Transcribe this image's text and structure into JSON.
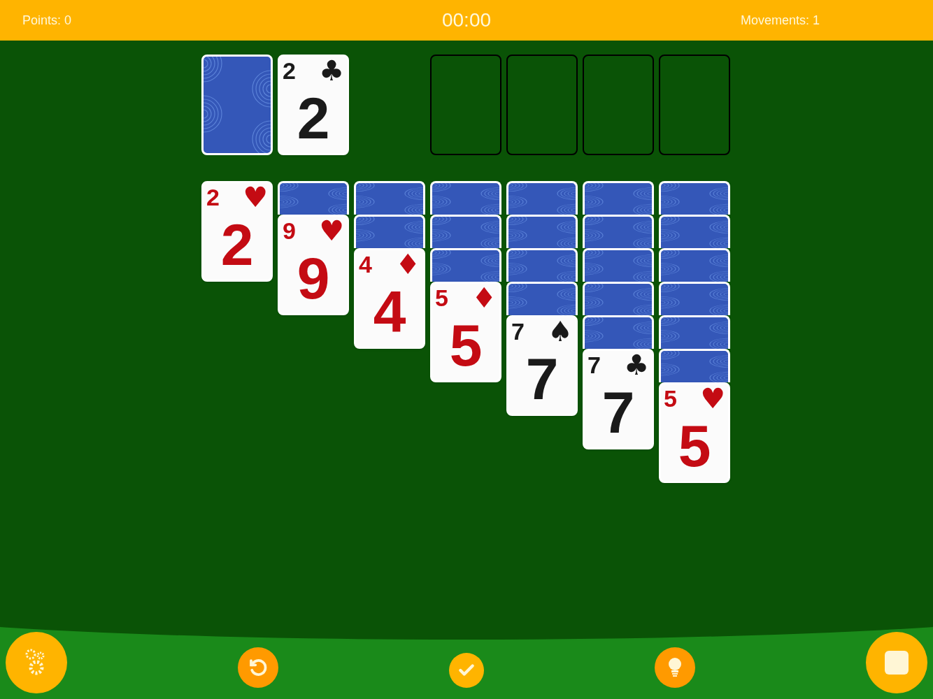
{
  "top_bar": {
    "points": "Points: 0",
    "timer": "00:00",
    "movements": "Movements: 1"
  },
  "stock": {
    "face_down": true
  },
  "waste": {
    "corner": "2",
    "suit": "♣",
    "center": "2",
    "color": "#1a1a1a"
  },
  "foundations": [
    {
      "empty": true
    },
    {
      "empty": true
    },
    {
      "empty": true
    },
    {
      "empty": true
    }
  ],
  "tableau": [
    {
      "cards": [
        {
          "face_up": true,
          "corner": "2",
          "suit": "♥",
          "center": "2",
          "color": "#c40b13"
        }
      ]
    },
    {
      "cards": [
        {
          "face_up": false
        },
        {
          "face_up": true,
          "corner": "9",
          "suit": "♥",
          "center": "9",
          "color": "#c40b13"
        }
      ]
    },
    {
      "cards": [
        {
          "face_up": false
        },
        {
          "face_up": false
        },
        {
          "face_up": true,
          "corner": "4",
          "suit": "♦",
          "center": "4",
          "color": "#c40b13"
        }
      ]
    },
    {
      "cards": [
        {
          "face_up": false
        },
        {
          "face_up": false
        },
        {
          "face_up": false
        },
        {
          "face_up": true,
          "corner": "5",
          "suit": "♦",
          "center": "5",
          "color": "#c40b13"
        }
      ]
    },
    {
      "cards": [
        {
          "face_up": false
        },
        {
          "face_up": false
        },
        {
          "face_up": false
        },
        {
          "face_up": false
        },
        {
          "face_up": true,
          "corner": "7",
          "suit": "♠",
          "center": "7",
          "color": "#1a1a1a"
        }
      ]
    },
    {
      "cards": [
        {
          "face_up": false
        },
        {
          "face_up": false
        },
        {
          "face_up": false
        },
        {
          "face_up": false
        },
        {
          "face_up": false
        },
        {
          "face_up": true,
          "corner": "7",
          "suit": "♣",
          "center": "7",
          "color": "#1a1a1a"
        }
      ]
    },
    {
      "cards": [
        {
          "face_up": false
        },
        {
          "face_up": false
        },
        {
          "face_up": false
        },
        {
          "face_up": false
        },
        {
          "face_up": false
        },
        {
          "face_up": false
        },
        {
          "face_up": true,
          "corner": "5",
          "suit": "♥",
          "center": "5",
          "color": "#c40b13"
        }
      ]
    }
  ]
}
